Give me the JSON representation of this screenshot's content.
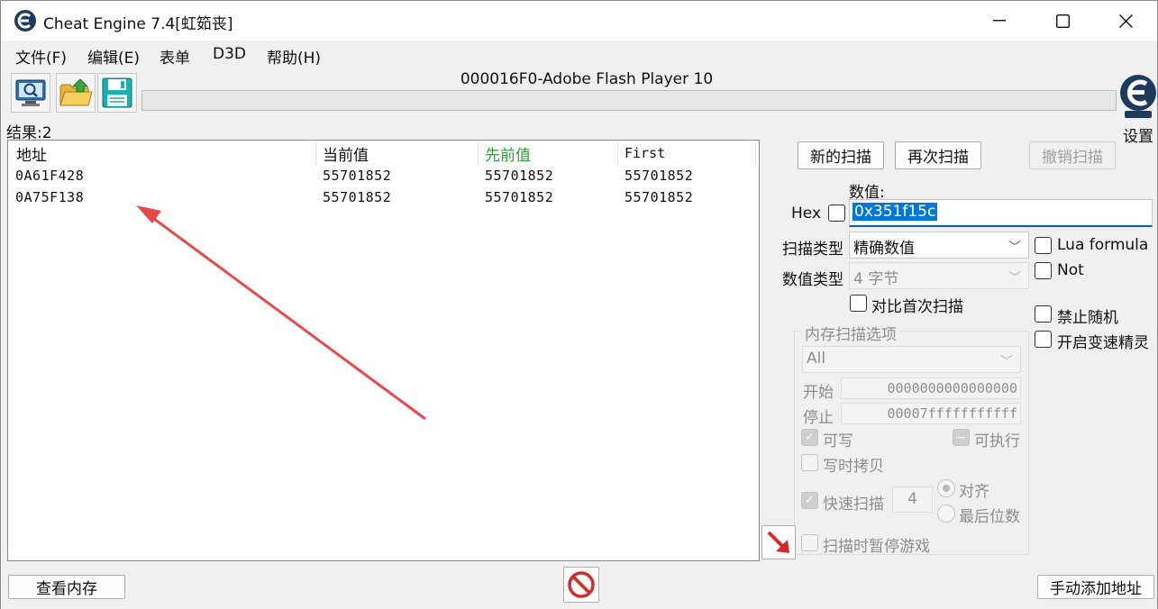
{
  "window": {
    "title": "Cheat Engine 7.4[虹筎丧]",
    "controls": {
      "minimize": "minimize",
      "maximize": "maximize",
      "close": "close"
    }
  },
  "menu": {
    "items": [
      "文件(F)",
      "编辑(E)",
      "表单",
      "D3D",
      "帮助(H)"
    ]
  },
  "toolbar": {
    "icons": [
      "monitor-search-icon",
      "open-folder-icon",
      "save-disk-icon"
    ],
    "process_title": "000016F0-Adobe Flash Player 10",
    "progress": 0,
    "settings_label": "设置"
  },
  "results": {
    "label": "结果:2",
    "columns": [
      "地址",
      "当前值",
      "先前值",
      "First"
    ],
    "previous_column_color": "#2e9e3a",
    "rows": [
      {
        "address": "0A61F428",
        "current": "55701852",
        "previous": "55701852",
        "first": "55701852"
      },
      {
        "address": "0A75F138",
        "current": "55701852",
        "previous": "55701852",
        "first": "55701852"
      }
    ]
  },
  "scan": {
    "new_scan": "新的扫描",
    "next_scan": "再次扫描",
    "undo_scan": "撤销扫描",
    "value_label": "数值:",
    "hex_label": "Hex",
    "hex_checked": false,
    "value": "0x351f15c",
    "scan_type_label": "扫描类型",
    "scan_type": "精确数值",
    "value_type_label": "数值类型",
    "value_type": "4 字节",
    "compare_first": "对比首次扫描",
    "lua_formula": "Lua formula",
    "not": "Not",
    "disable_random": "禁止随机",
    "speedhack": "开启变速精灵"
  },
  "memory_options": {
    "title": "内存扫描选项",
    "region": "All",
    "start_label": "开始",
    "start_value": "0000000000000000",
    "stop_label": "停止",
    "stop_value": "00007fffffffffff",
    "writable": "可写",
    "executable": "可执行",
    "copy_on_write": "写时拷贝",
    "fast_scan": "快速扫描",
    "fast_scan_value": "4",
    "align": "对齐",
    "last_digits": "最后位数",
    "pause_game": "扫描时暂停游戏"
  },
  "bottom": {
    "view_memory": "查看内存",
    "add_address": "手动添加地址"
  },
  "colors": {
    "accent": "#0078d7",
    "annotation_arrow": "#e84a4a",
    "stop_icon": "#d22b2b"
  }
}
